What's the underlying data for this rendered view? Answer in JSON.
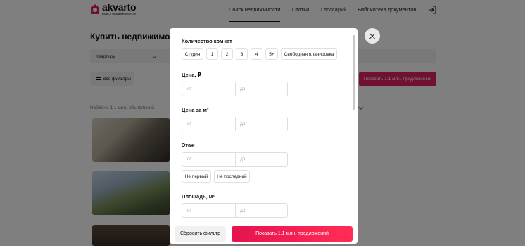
{
  "header": {
    "logo": {
      "name": "akvarto",
      "tagline": "поиск недвижимости"
    },
    "nav": [
      {
        "label": "Поиск недвижимости",
        "active": true
      },
      {
        "label": "Статьи",
        "active": false
      },
      {
        "label": "Глоссарий",
        "active": false
      },
      {
        "label": "Библиотека документов",
        "active": false
      }
    ]
  },
  "main": {
    "title": "Купить недвижимость",
    "property_type": "Квартиру",
    "all_filters": "Все фильтры",
    "show_button": "Показать 1.1 млн. предложений",
    "found": "Найдено 1.1 млн. объявлений"
  },
  "modal": {
    "rooms": {
      "title": "Количество комнат",
      "options": [
        "Студия",
        "1",
        "2",
        "3",
        "4",
        "5+",
        "Свободная планировка"
      ]
    },
    "price": {
      "title": "Цена, ₽",
      "from": "от",
      "to": "до"
    },
    "price_per_m2": {
      "title": "Цена за м²",
      "from": "от",
      "to": "до"
    },
    "floor": {
      "title": "Этаж",
      "from": "от",
      "to": "до",
      "options": [
        "Не первый",
        "Не последний"
      ]
    },
    "area": {
      "title": "Площадь, м²",
      "from": "от",
      "to": "до"
    },
    "reset": "Сбросить фильтр",
    "show": "Показать 1.1 млн. предложений"
  },
  "colors": {
    "accent": "#e5134f",
    "overlay": "rgba(0,0,0,0.5)"
  },
  "icons": [
    "logo-house-icon",
    "login-icon",
    "filter-lines-icon",
    "chevron-down-icon",
    "close-icon"
  ]
}
